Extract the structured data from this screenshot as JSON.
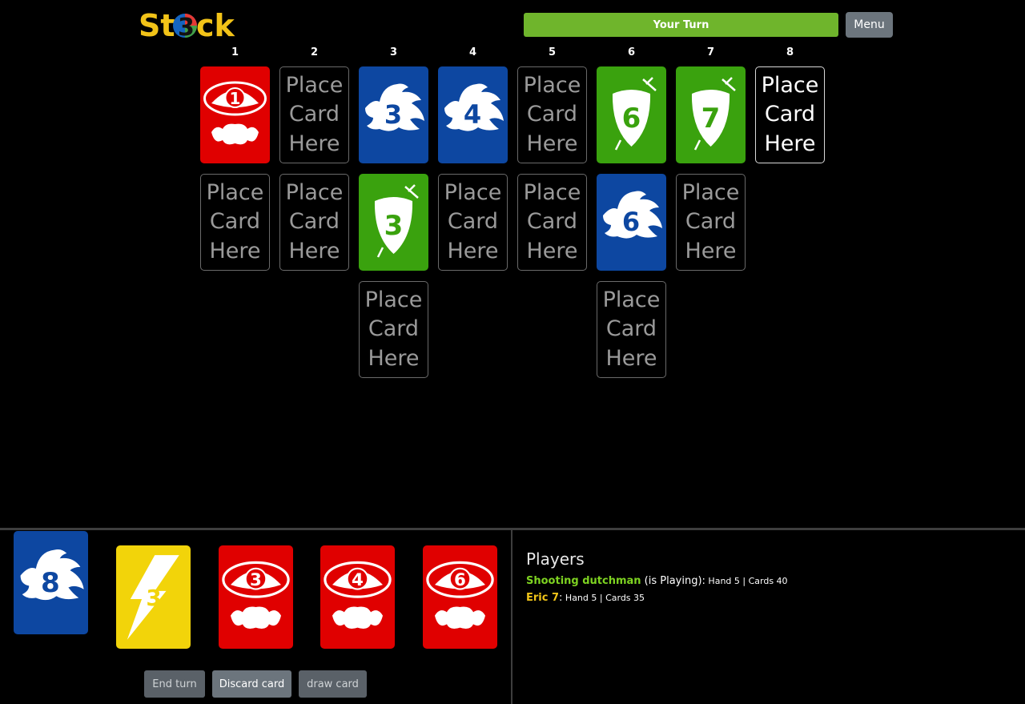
{
  "header": {
    "logo_text": "St3ck",
    "turn_label": "Your Turn",
    "menu_label": "Menu"
  },
  "columns": [
    "1",
    "2",
    "3",
    "4",
    "5",
    "6",
    "7",
    "8"
  ],
  "placeholder": {
    "line1": "Place",
    "line2": "Card",
    "line3": "Here"
  },
  "board": [
    {
      "column": "1",
      "row": 1,
      "type": "card",
      "color": "red",
      "value": "1",
      "icon": "mario-hat-mustache-icon"
    },
    {
      "column": "2",
      "row": 1,
      "type": "placeholder"
    },
    {
      "column": "3",
      "row": 1,
      "type": "card",
      "color": "blue",
      "value": "3",
      "icon": "sonic-head-icon"
    },
    {
      "column": "4",
      "row": 1,
      "type": "card",
      "color": "blue",
      "value": "4",
      "icon": "sonic-head-icon"
    },
    {
      "column": "5",
      "row": 1,
      "type": "placeholder"
    },
    {
      "column": "6",
      "row": 1,
      "type": "card",
      "color": "green",
      "value": "6",
      "icon": "zelda-shield-sword-icon"
    },
    {
      "column": "7",
      "row": 1,
      "type": "card",
      "color": "green",
      "value": "7",
      "icon": "zelda-shield-sword-icon"
    },
    {
      "column": "8",
      "row": 1,
      "type": "placeholder",
      "active": true
    },
    {
      "column": "1",
      "row": 2,
      "type": "placeholder"
    },
    {
      "column": "2",
      "row": 2,
      "type": "placeholder"
    },
    {
      "column": "3",
      "row": 2,
      "type": "card",
      "color": "green",
      "value": "3",
      "icon": "zelda-shield-sword-icon"
    },
    {
      "column": "4",
      "row": 2,
      "type": "placeholder"
    },
    {
      "column": "5",
      "row": 2,
      "type": "placeholder"
    },
    {
      "column": "6",
      "row": 2,
      "type": "card",
      "color": "blue",
      "value": "6",
      "icon": "sonic-head-icon"
    },
    {
      "column": "7",
      "row": 2,
      "type": "placeholder"
    },
    {
      "column": "3",
      "row": 3,
      "type": "placeholder"
    },
    {
      "column": "6",
      "row": 3,
      "type": "placeholder"
    }
  ],
  "hand": [
    {
      "color": "blue",
      "value": "8",
      "icon": "sonic-head-icon",
      "selected": true
    },
    {
      "color": "yellow",
      "value": "3",
      "icon": "lightning-bolt-icon"
    },
    {
      "color": "red",
      "value": "3",
      "icon": "mario-hat-mustache-icon"
    },
    {
      "color": "red",
      "value": "4",
      "icon": "mario-hat-mustache-icon"
    },
    {
      "color": "red",
      "value": "6",
      "icon": "mario-hat-mustache-icon"
    }
  ],
  "actions": {
    "end_turn": "End turn",
    "discard_card": "Discard card",
    "draw_card": "draw card"
  },
  "players": {
    "title": "Players",
    "list": [
      {
        "name": "Shooting dutchman",
        "status": " (is Playing):",
        "stats": " Hand 5 | Cards 40",
        "color": "#7ed321"
      },
      {
        "name": "Eric 7",
        "status": ":",
        "stats": " Hand 5 | Cards 35",
        "color": "#f0c419"
      }
    ]
  },
  "colors": {
    "red": "#e00000",
    "blue": "#0d47a1",
    "green": "#3aa20e",
    "yellow": "#f2d40a",
    "accent": "#6fb52c"
  }
}
